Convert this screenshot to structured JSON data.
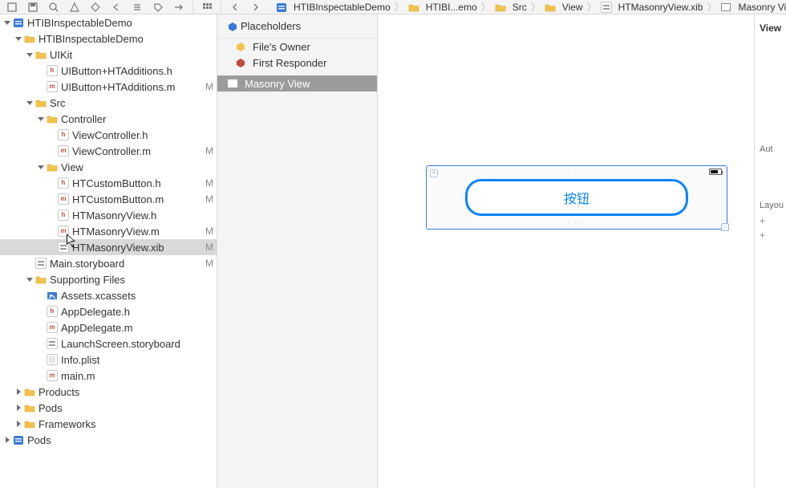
{
  "toolbar": {
    "nav_icons": [
      "square-icon",
      "floppy-icon",
      "search-icon",
      "warning-icon",
      "diff-icon",
      "arrow-left-icon",
      "list-icon",
      "tag-icon",
      "arrow-right-range-icon"
    ],
    "mode_icons": [
      "grid3-icon"
    ],
    "history_icons": [
      "chevron-left-icon",
      "chevron-right-icon"
    ]
  },
  "breadcrumbs": [
    {
      "icon": "proj",
      "label": "HTIBInspectableDemo"
    },
    {
      "icon": "folder",
      "label": "HTIBI...emo"
    },
    {
      "icon": "folder",
      "label": "Src"
    },
    {
      "icon": "folder",
      "label": "View"
    },
    {
      "icon": "xib",
      "label": "HTMasonryView.xib"
    },
    {
      "icon": "view",
      "label": "Masonry View"
    }
  ],
  "navigator": {
    "tree": [
      {
        "depth": 0,
        "icon": "proj",
        "label": "HTIBInspectableDemo",
        "status": "",
        "expanded": true,
        "children": true
      },
      {
        "depth": 1,
        "icon": "folder",
        "label": "HTIBInspectableDemo",
        "status": "",
        "expanded": true,
        "children": true
      },
      {
        "depth": 2,
        "icon": "folder",
        "label": "UIKit",
        "status": "",
        "expanded": true,
        "children": true
      },
      {
        "depth": 3,
        "icon": "h",
        "label": "UIButton+HTAdditions.h",
        "status": ""
      },
      {
        "depth": 3,
        "icon": "m",
        "label": "UIButton+HTAdditions.m",
        "status": "M"
      },
      {
        "depth": 2,
        "icon": "folder",
        "label": "Src",
        "status": "",
        "expanded": true,
        "children": true
      },
      {
        "depth": 3,
        "icon": "folder",
        "label": "Controller",
        "status": "",
        "expanded": true,
        "children": true
      },
      {
        "depth": 4,
        "icon": "h",
        "label": "ViewController.h",
        "status": ""
      },
      {
        "depth": 4,
        "icon": "m",
        "label": "ViewController.m",
        "status": "M"
      },
      {
        "depth": 3,
        "icon": "folder",
        "label": "View",
        "status": "",
        "expanded": true,
        "children": true
      },
      {
        "depth": 4,
        "icon": "h",
        "label": "HTCustomButton.h",
        "status": "M"
      },
      {
        "depth": 4,
        "icon": "m",
        "label": "HTCustomButton.m",
        "status": "M"
      },
      {
        "depth": 4,
        "icon": "h",
        "label": "HTMasonryView.h",
        "status": ""
      },
      {
        "depth": 4,
        "icon": "m",
        "label": "HTMasonryView.m",
        "status": "M"
      },
      {
        "depth": 4,
        "icon": "xib",
        "label": "HTMasonryView.xib",
        "status": "M",
        "selected": true
      },
      {
        "depth": 2,
        "icon": "story",
        "label": "Main.storyboard",
        "status": "M"
      },
      {
        "depth": 2,
        "icon": "folder",
        "label": "Supporting Files",
        "status": "",
        "expanded": true,
        "children": true
      },
      {
        "depth": 3,
        "icon": "assets",
        "label": "Assets.xcassets",
        "status": ""
      },
      {
        "depth": 3,
        "icon": "h",
        "label": "AppDelegate.h",
        "status": ""
      },
      {
        "depth": 3,
        "icon": "m",
        "label": "AppDelegate.m",
        "status": ""
      },
      {
        "depth": 3,
        "icon": "story",
        "label": "LaunchScreen.storyboard",
        "status": ""
      },
      {
        "depth": 3,
        "icon": "plist",
        "label": "Info.plist",
        "status": ""
      },
      {
        "depth": 3,
        "icon": "m",
        "label": "main.m",
        "status": ""
      },
      {
        "depth": 1,
        "icon": "folder",
        "label": "Products",
        "status": "",
        "children": true
      },
      {
        "depth": 1,
        "icon": "folder",
        "label": "Pods",
        "status": "",
        "children": true
      },
      {
        "depth": 1,
        "icon": "folder",
        "label": "Frameworks",
        "status": "",
        "children": true
      },
      {
        "depth": 0,
        "icon": "proj",
        "label": "Pods",
        "status": "",
        "children": true
      }
    ]
  },
  "outline": {
    "header": "Placeholders",
    "items": [
      {
        "icon": "cube-yellow",
        "label": "File's Owner"
      },
      {
        "icon": "cube-red",
        "label": "First Responder"
      }
    ],
    "selection": {
      "icon": "view",
      "label": "Masonry View"
    }
  },
  "canvas": {
    "button_label": "按钮"
  },
  "inspector": {
    "title": "View",
    "labels": [
      "Aut",
      "Layou"
    ],
    "plus": "+"
  }
}
